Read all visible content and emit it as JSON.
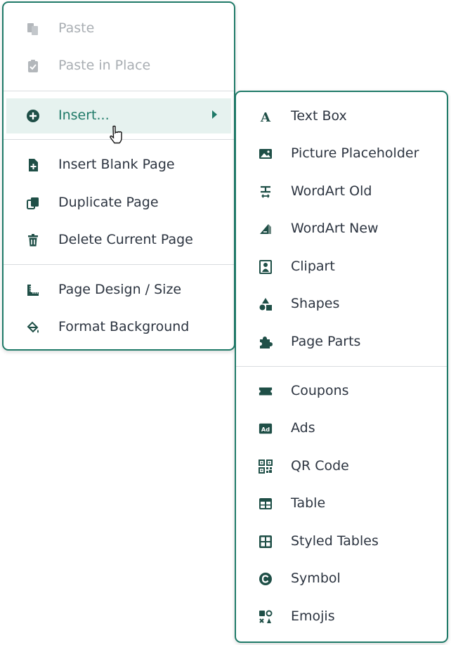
{
  "context_menu": {
    "items": [
      {
        "label": "Paste",
        "icon": "paste-icon",
        "state": "disabled"
      },
      {
        "label": "Paste in Place",
        "icon": "clipboard-check-icon",
        "state": "disabled"
      },
      {
        "label": "Insert...",
        "icon": "plus-circle-icon",
        "state": "active"
      },
      {
        "label": "Insert Blank Page",
        "icon": "page-add-icon"
      },
      {
        "label": "Duplicate Page",
        "icon": "duplicate-icon"
      },
      {
        "label": "Delete Current Page",
        "icon": "trash-icon"
      },
      {
        "label": "Page Design / Size",
        "icon": "ruler-icon"
      },
      {
        "label": "Format Background",
        "icon": "paint-bucket-icon"
      }
    ]
  },
  "insert_submenu": {
    "items": [
      {
        "label": "Text Box",
        "icon": "text-a-icon"
      },
      {
        "label": "Picture Placeholder",
        "icon": "image-icon"
      },
      {
        "label": "WordArt Old",
        "icon": "wordart-old-icon"
      },
      {
        "label": "WordArt New",
        "icon": "wordart-new-icon"
      },
      {
        "label": "Clipart",
        "icon": "clipart-icon"
      },
      {
        "label": "Shapes",
        "icon": "shapes-icon"
      },
      {
        "label": "Page Parts",
        "icon": "puzzle-icon"
      },
      {
        "label": "Coupons",
        "icon": "ticket-icon"
      },
      {
        "label": "Ads",
        "icon": "ad-icon"
      },
      {
        "label": "QR Code",
        "icon": "qr-code-icon"
      },
      {
        "label": "Table",
        "icon": "table-icon"
      },
      {
        "label": "Styled Tables",
        "icon": "styled-table-icon"
      },
      {
        "label": "Symbol",
        "icon": "copyright-symbol-icon"
      },
      {
        "label": "Emojis",
        "icon": "emoji-icon"
      }
    ]
  },
  "colors": {
    "accent": "#1f7a68",
    "text": "#2c3440",
    "disabled": "#a9aeb3",
    "active_bg": "#e6f2ef"
  }
}
